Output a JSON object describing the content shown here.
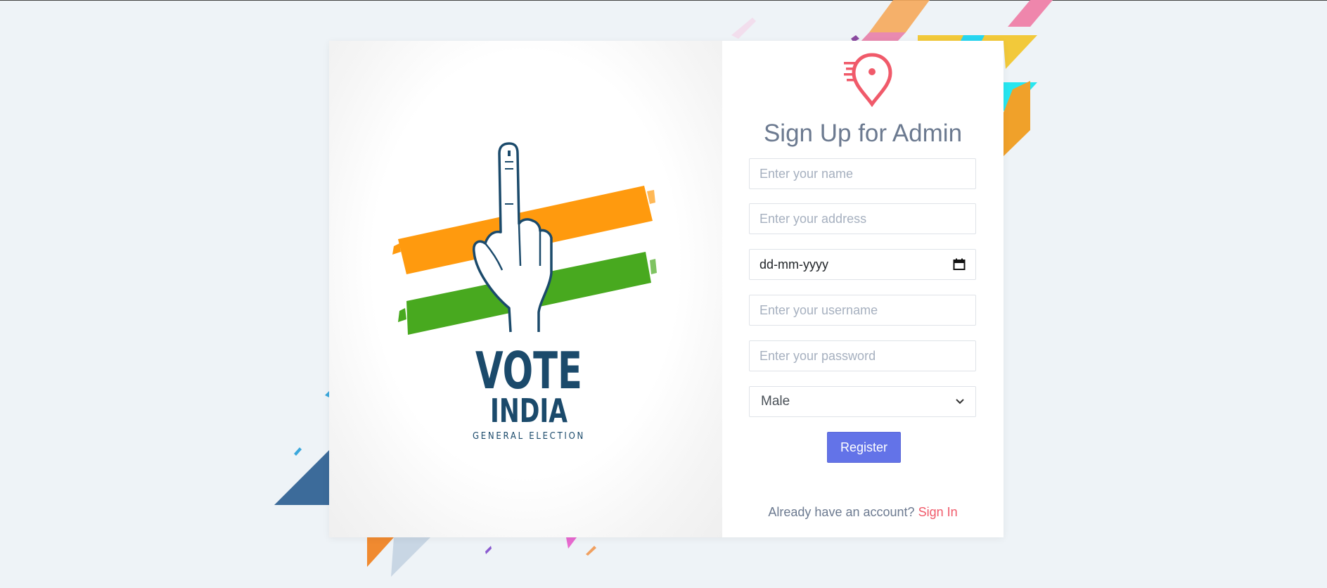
{
  "form": {
    "title": "Sign Up for Admin",
    "name_placeholder": "Enter your name",
    "address_placeholder": "Enter your address",
    "date_value": "dd-mm-yyyy",
    "username_placeholder": "Enter your username",
    "password_placeholder": "Enter your password",
    "gender_value": "Male",
    "register_label": "Register"
  },
  "footer": {
    "prompt": "Already have an account?",
    "signin_label": "Sign In"
  },
  "illustration": {
    "line1": "VOTE",
    "line2": "INDIA",
    "line3": "GENERAL ELECTION"
  },
  "icons": {
    "logo": "map-pin-speed-icon",
    "date": "calendar-icon",
    "select": "chevron-down-icon"
  },
  "colors": {
    "accent": "#6373e8",
    "link": "#f05a6a",
    "saffron": "#ff9a0e",
    "green": "#48a91f",
    "navy": "#1b4a6b"
  }
}
